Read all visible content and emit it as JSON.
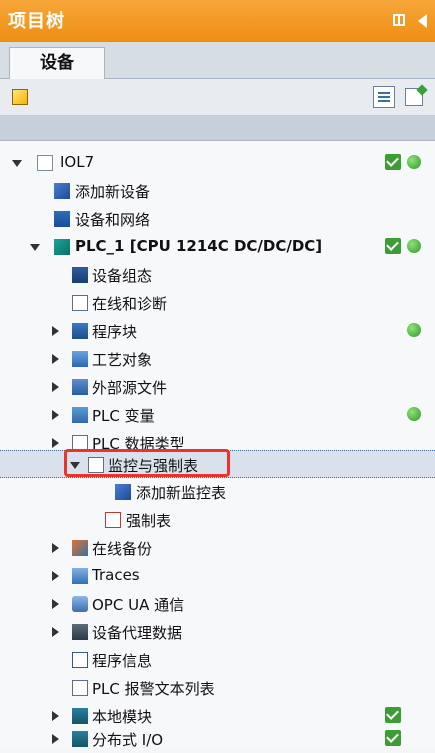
{
  "panel": {
    "title": "项目树"
  },
  "tabs": {
    "devices": "设备"
  },
  "tree": {
    "items": [
      {
        "label": "IOL7",
        "bold": false
      },
      {
        "label": "添加新设备",
        "bold": false
      },
      {
        "label": "设备和网络",
        "bold": false
      },
      {
        "label": "PLC_1 [CPU 1214C DC/DC/DC]",
        "bold": true
      },
      {
        "label": "设备组态",
        "bold": false
      },
      {
        "label": "在线和诊断",
        "bold": false
      },
      {
        "label": "程序块",
        "bold": false
      },
      {
        "label": "工艺对象",
        "bold": false
      },
      {
        "label": "外部源文件",
        "bold": false
      },
      {
        "label": "PLC 变量",
        "bold": false
      },
      {
        "label": "PLC 数据类型",
        "bold": false
      },
      {
        "label": "监控与强制表",
        "bold": false
      },
      {
        "label": "添加新监控表",
        "bold": false
      },
      {
        "label": "强制表",
        "bold": false
      },
      {
        "label": "在线备份",
        "bold": false
      },
      {
        "label": "Traces",
        "bold": false
      },
      {
        "label": "OPC UA 通信",
        "bold": false
      },
      {
        "label": "设备代理数据",
        "bold": false
      },
      {
        "label": "程序信息",
        "bold": false
      },
      {
        "label": "PLC 报警文本列表",
        "bold": false
      },
      {
        "label": "本地模块",
        "bold": false
      },
      {
        "label": "分布式 I/O",
        "bold": false
      }
    ]
  },
  "colors": {
    "title_bar": "#f29a1f",
    "status_green": "#3c9d34",
    "highlight_red": "#e8342d",
    "selected_row": "#d9e2ec"
  },
  "icons": {
    "pin": "pin-icon",
    "collapse": "collapse-arrow-icon",
    "new_device": "add-device-icon",
    "view": "details-view-icon",
    "export": "export-icon",
    "status_ok": "check-status-icon",
    "online": "online-status-icon"
  }
}
